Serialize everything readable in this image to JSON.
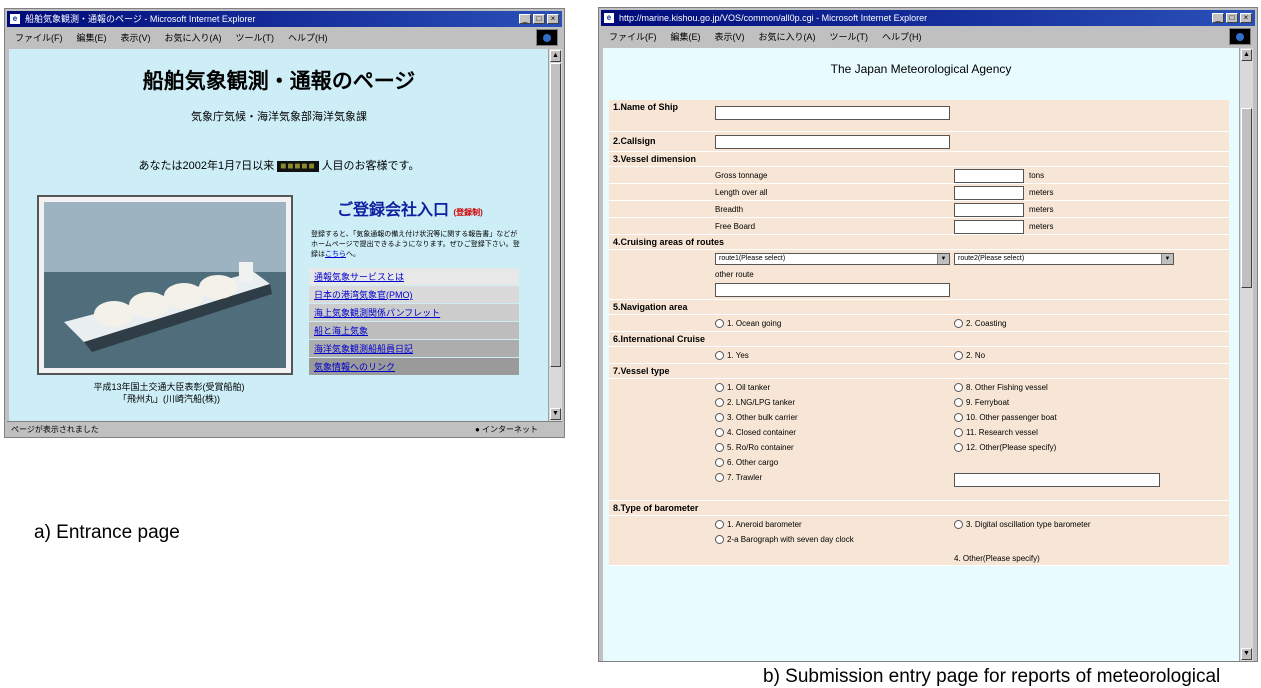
{
  "window_a": {
    "title": "船舶気象観測・通報のページ - Microsoft Internet Explorer",
    "menu": [
      "ファイル(F)",
      "編集(E)",
      "表示(V)",
      "お気に入り(A)",
      "ツール(T)",
      "ヘルプ(H)"
    ],
    "status": "ページが表示されました",
    "zone": "インターネット"
  },
  "entrance": {
    "title": "船舶気象観測・通報のページ",
    "subtitle": "気象庁気候・海洋気象部海洋気象課",
    "visit_prefix": "あなたは2002年1月7日以来",
    "visit_counter": "■■■■■",
    "visit_suffix": "人目のお客様です。",
    "members_heading": "ご登録会社入口",
    "members_note": "(登録制)",
    "members_text": "登録すると、「気象通報の備え付け状況等に関する報告書」などがホームページで提出できるようになります。ぜひご登録下さい。登録は",
    "members_link": "こちら",
    "members_text_end": "へ。",
    "links": [
      "通報気象サービスとは",
      "日本の港湾気象官(PMO)",
      "海上気象観測関係パンフレット",
      "船と海上気象",
      "海洋気象観測船船員日記",
      "気象情報へのリンク"
    ],
    "caption_line1": "平成13年国土交通大臣表彰(受賞船舶)",
    "caption_line2": "「飛州丸」(川崎汽船(株))"
  },
  "window_b": {
    "title": "http://marine.kishou.go.jp/VOS/common/all0p.cgi - Microsoft Internet Explorer",
    "menu": [
      "ファイル(F)",
      "編集(E)",
      "表示(V)",
      "お気に入り(A)",
      "ツール(T)",
      "ヘルプ(H)"
    ]
  },
  "form": {
    "header": "The Japan Meteorological Agency",
    "s1": "1.Name of Ship",
    "s2": "2.Callsign",
    "s3": "3.Vessel dimension",
    "gross": "Gross tonnage",
    "gross_unit": "tons",
    "length": "Length over all",
    "length_unit": "meters",
    "breadth": "Breadth",
    "breadth_unit": "meters",
    "freeboard": "Free Board",
    "freeboard_unit": "meters",
    "s4": "4.Cruising areas of routes",
    "route1": "route1(Please select)",
    "route2": "route2(Please select)",
    "other_route": "other route",
    "s5": "5.Navigation area",
    "nav1": "1. Ocean going",
    "nav2": "2. Coasting",
    "s6": "6.International Cruise",
    "int1": "1. Yes",
    "int2": "2. No",
    "s7": "7.Vessel type",
    "vt_left": [
      "1. Oil tanker",
      "2. LNG/LPG tanker",
      "3. Other bulk carrier",
      "4. Closed container",
      "5. Ro/Ro container",
      "6. Other cargo",
      "7. Trawler"
    ],
    "vt_right": [
      "8. Other Fishing vessel",
      "9. Ferryboat",
      "10. Other passenger boat",
      "11. Research vessel",
      "12. Other(Please specify)"
    ],
    "s8": "8.Type of barometer",
    "bar1": "1. Aneroid barometer",
    "bar2": "2-a Barograph with seven day clock",
    "bar3": "3. Digital oscillation type barometer",
    "bar4": "4. Other(Please specify)"
  },
  "captions": {
    "a": "a)  Entrance page",
    "b": "b)  Submission entry page for reports of meteorological"
  }
}
